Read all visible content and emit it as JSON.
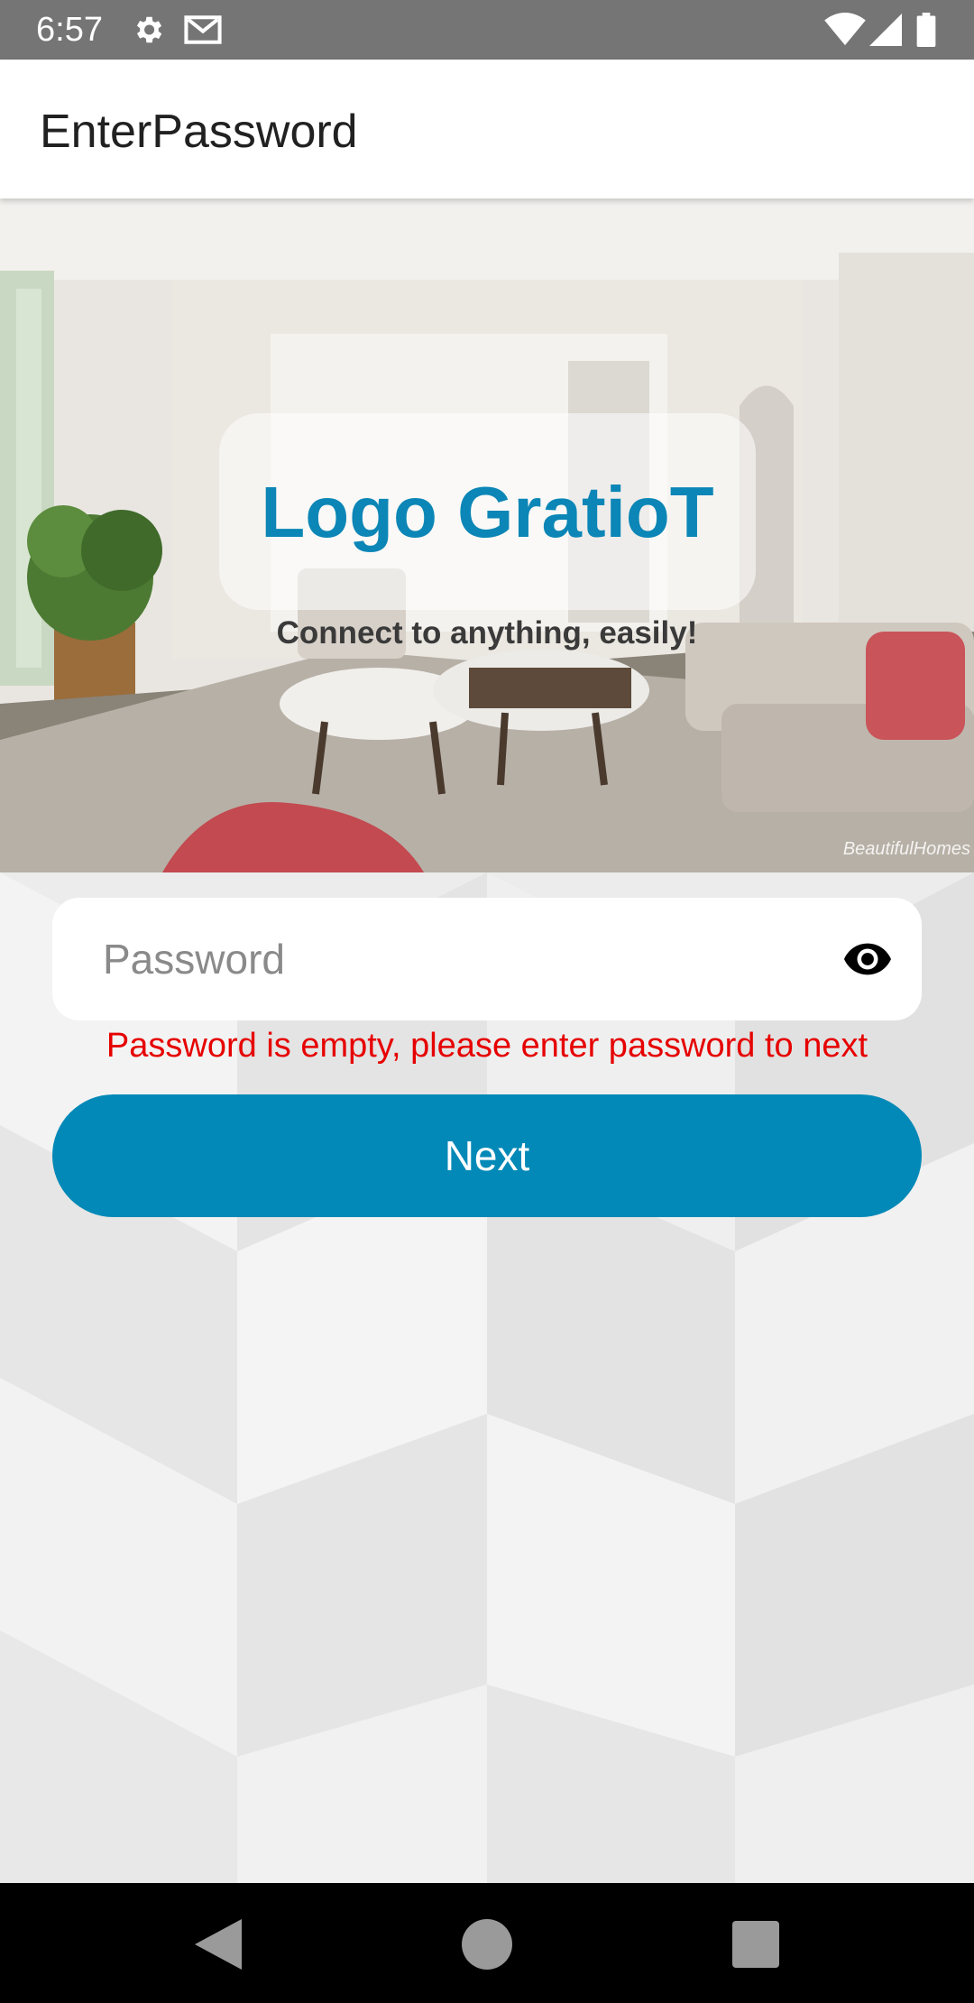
{
  "status_bar": {
    "time": "6:57",
    "icons": [
      "gear-icon",
      "gmail-icon",
      "wifi-icon",
      "signal-icon",
      "battery-icon"
    ]
  },
  "app_bar": {
    "title": "EnterPassword"
  },
  "hero": {
    "logo_text": "Logo GratioT",
    "tagline": "Connect to anything, easily!",
    "watermark": "BeautifulHomes"
  },
  "form": {
    "password_placeholder": "Password",
    "password_value": "",
    "error_message": "Password is empty, please enter password to next",
    "next_label": "Next"
  },
  "nav_bar": {
    "buttons": [
      "back-icon",
      "home-icon",
      "recents-icon"
    ]
  },
  "colors": {
    "accent": "#0389b7",
    "logo": "#0b86b6",
    "error": "#e60000",
    "status_bar": "#757575"
  }
}
